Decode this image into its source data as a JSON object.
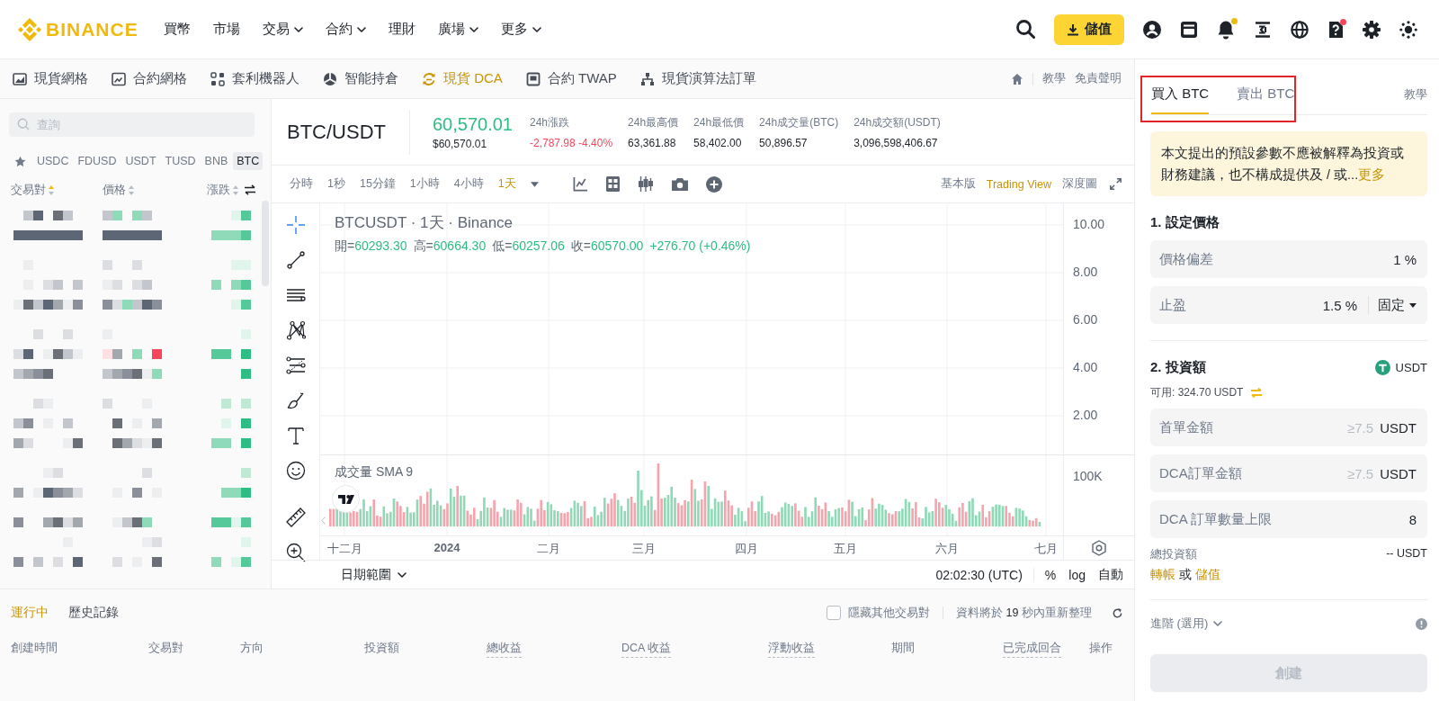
{
  "header": {
    "logo": "BINANCE",
    "nav": [
      {
        "label": "買幣",
        "dropdown": false
      },
      {
        "label": "市場",
        "dropdown": false
      },
      {
        "label": "交易",
        "dropdown": true
      },
      {
        "label": "合約",
        "dropdown": true
      },
      {
        "label": "理財",
        "dropdown": false
      },
      {
        "label": "廣場",
        "dropdown": true
      },
      {
        "label": "更多",
        "dropdown": true
      }
    ],
    "deposit_button": "儲值",
    "notification_dot": true,
    "help_dot": true
  },
  "bot_tabs": {
    "items": [
      {
        "label": "現貨網格",
        "selected": false
      },
      {
        "label": "合約網格",
        "selected": false
      },
      {
        "label": "套利機器人",
        "selected": false
      },
      {
        "label": "智能持倉",
        "selected": false
      },
      {
        "label": "現貨 DCA",
        "selected": true
      },
      {
        "label": "合約 TWAP",
        "selected": false
      },
      {
        "label": "現貨演算法訂單",
        "selected": false
      }
    ],
    "links": [
      "教學",
      "免責聲明"
    ]
  },
  "market_list": {
    "search": {
      "placeholder": "查詢"
    },
    "quote_tabs": [
      {
        "label": "USDC",
        "selected": false
      },
      {
        "label": "FDUSD",
        "selected": false
      },
      {
        "label": "USDT",
        "selected": false
      },
      {
        "label": "TUSD",
        "selected": false
      },
      {
        "label": "BNB",
        "selected": false
      },
      {
        "label": "BTC",
        "selected": true
      }
    ],
    "columns": [
      {
        "label": "交易對",
        "sorted": true
      },
      {
        "label": "價格",
        "sorted": false
      },
      {
        "label": "漲跌",
        "sorted": false
      }
    ],
    "rows_pixelated": true
  },
  "ticker": {
    "pair": "BTC/USDT",
    "price": "60,570.01",
    "rising": true,
    "price_usd": "$60,570.01",
    "stats": [
      {
        "label": "24h漲跌",
        "value": "-2,787.98 -4.40%",
        "negative": true
      },
      {
        "label": "24h最高價",
        "value": "63,361.88",
        "negative": false
      },
      {
        "label": "24h最低價",
        "value": "58,402.00",
        "negative": false
      },
      {
        "label": "24h成交量(BTC)",
        "value": "50,896.57",
        "negative": false
      },
      {
        "label": "24h成交額(USDT)",
        "value": "3,096,598,406.67",
        "negative": false
      }
    ]
  },
  "chart_toolbar": {
    "intervals": [
      {
        "label": "分時",
        "selected": false
      },
      {
        "label": "1秒",
        "selected": false
      },
      {
        "label": "15分鐘",
        "selected": false
      },
      {
        "label": "1小時",
        "selected": false
      },
      {
        "label": "4小時",
        "selected": false
      },
      {
        "label": "1天",
        "selected": true
      }
    ],
    "views": [
      {
        "label": "基本版",
        "selected": false
      },
      {
        "label": "Trading View",
        "selected": true
      },
      {
        "label": "深度圖",
        "selected": false
      }
    ]
  },
  "chart": {
    "title": "BTCUSDT · 1天 · Binance",
    "ohlc": [
      {
        "label": "開=",
        "value": "60293.30"
      },
      {
        "label": "高=",
        "value": "60664.30"
      },
      {
        "label": "低=",
        "value": "60257.06"
      },
      {
        "label": "收=",
        "value": "60570.00"
      }
    ],
    "change": "+276.70 (+0.46%)",
    "price_axis": [
      "10.00",
      "8.00",
      "6.00",
      "4.00",
      "2.00"
    ],
    "volume_label": "成交量 SMA 9",
    "volume_axis": "100K",
    "time_axis": [
      {
        "label": "十二月",
        "bold": false
      },
      {
        "label": "2024",
        "bold": true
      },
      {
        "label": "二月",
        "bold": false
      },
      {
        "label": "三月",
        "bold": false
      },
      {
        "label": "四月",
        "bold": false
      },
      {
        "label": "五月",
        "bold": false
      },
      {
        "label": "六月",
        "bold": false
      },
      {
        "label": "七月",
        "bold": false
      }
    ],
    "date_range": "日期範圍",
    "clock": "02:02:30 (UTC)",
    "scale_options": [
      "%",
      "log",
      "自動"
    ]
  },
  "orders": {
    "tabs": [
      {
        "label": "運行中",
        "selected": true
      },
      {
        "label": "歷史記錄",
        "selected": false
      }
    ],
    "hide_other_pairs": {
      "label": "隱藏其他交易對",
      "checked": false
    },
    "refresh_note": "資料將於 **19** 秒內重新整理",
    "columns": [
      {
        "label": "創建時間",
        "tooltip": false
      },
      {
        "label": "交易對",
        "tooltip": false
      },
      {
        "label": "方向",
        "tooltip": false
      },
      {
        "label": "投資額",
        "tooltip": false
      },
      {
        "label": "總收益",
        "tooltip": true
      },
      {
        "label": "DCA 收益",
        "tooltip": true
      },
      {
        "label": "浮動收益",
        "tooltip": true
      },
      {
        "label": "期間",
        "tooltip": false
      },
      {
        "label": "已完成回合",
        "tooltip": true
      },
      {
        "label": "操作",
        "tooltip": false
      }
    ]
  },
  "trade_panel": {
    "tabs": [
      {
        "label": "買入 BTC",
        "selected": true
      },
      {
        "label": "賣出 BTC",
        "selected": false
      }
    ],
    "tabs_highlighted": true,
    "help_link": "教學",
    "notice": {
      "text": "本文提出的預設參數不應被解釋為投資或財務建議，也不構成提供及 / 或...",
      "more": "更多"
    },
    "price_section": {
      "title": "1. 設定價格",
      "fields": [
        {
          "label": "價格偏差",
          "value": "1 %"
        },
        {
          "label": "止盈",
          "value": "1.5 %",
          "mode": "固定"
        }
      ]
    },
    "investment": {
      "title": "2. 投資額",
      "currency": "USDT",
      "available": "可用: 324.70 USDT",
      "fields": [
        {
          "label": "首單金額",
          "placeholder": "≥7.5",
          "unit": "USDT"
        },
        {
          "label": "DCA訂單金額",
          "placeholder": "≥7.5",
          "unit": "USDT"
        },
        {
          "label": "DCA 訂單數量上限",
          "value": "8"
        }
      ],
      "total_label": "總投資額",
      "total_value": "-- USDT",
      "transfer_link": "轉帳",
      "or": "或",
      "deposit_link": "儲值"
    },
    "advanced": "進階 (選用)",
    "create_button": {
      "label": "創建",
      "disabled": true
    }
  }
}
